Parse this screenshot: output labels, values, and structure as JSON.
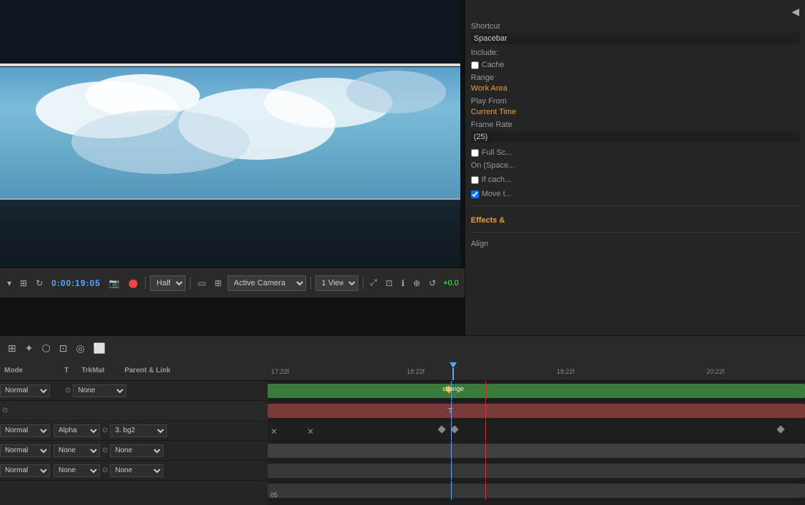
{
  "preview": {
    "time": "0:00:19:05",
    "quality": "Half",
    "view": "Active Camera",
    "layout": "1 View",
    "speed": "+0.0"
  },
  "right_panel": {
    "collapse_icon": "◀",
    "shortcut_label": "Shortcut",
    "shortcut_value": "Spacebar",
    "include_label": "Include:",
    "cache_label": "Cache",
    "range_label": "Range",
    "range_value": "Work Area",
    "play_from_label": "Play From",
    "play_from_value": "Current Time",
    "frame_rate_label": "Frame Rate",
    "frame_rate_value": "(25)",
    "full_screen_label": "Full Sc...",
    "on_space_label": "On (Space...",
    "if_cache_label": "If cach...",
    "move_to_label": "Move t...",
    "effects_label": "Effects &",
    "align_label": "Align"
  },
  "timeline": {
    "toolbar_icons": [
      "⊞",
      "✦",
      "⬡",
      "⊡",
      "◎",
      "⬜"
    ],
    "header_mode": "Mode",
    "header_t": "T",
    "header_trkmat": "TrkMat",
    "header_parent": "Parent & Link",
    "layers": [
      {
        "mode": "Normal",
        "t": "",
        "trkmat": "",
        "parent": "None",
        "name": ""
      },
      {
        "mode": "Normal",
        "t": "",
        "trkmat": "Alpha",
        "parent": "3. bg2",
        "name": "3. bg2"
      },
      {
        "mode": "Normal",
        "t": "",
        "trkmat": "None",
        "parent": "None",
        "name": ""
      },
      {
        "mode": "Normal",
        "t": "",
        "trkmat": "None",
        "parent": "None",
        "name": ""
      }
    ],
    "ruler_marks": [
      "17:22f",
      "18:22f",
      "19:22f",
      "20:22f"
    ],
    "change_label": "change",
    "number_label": "05"
  }
}
